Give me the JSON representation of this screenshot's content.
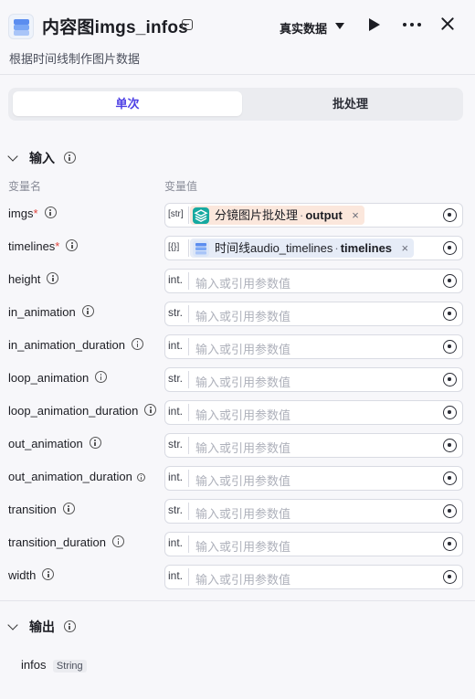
{
  "header": {
    "title": "内容图imgs_infos",
    "subtitle": "根据时间线制作图片数据",
    "data_mode": "真实数据",
    "icons": {
      "node": "layers-stack-icon",
      "badge": "node-badge-icon",
      "caret": "caret-down-icon",
      "run": "play-icon",
      "more": "more-horizontal-icon",
      "close": "close-icon"
    }
  },
  "tabs": [
    {
      "label": "单次",
      "active": true
    },
    {
      "label": "批处理",
      "active": false
    }
  ],
  "input_section": {
    "title": "输入",
    "col_name": "变量名",
    "col_value": "变量值",
    "rows": [
      {
        "name": "imgs",
        "required": true,
        "type": "[str]",
        "ref": {
          "source": "分镜图片批处理",
          "output": "output",
          "style": "orange"
        }
      },
      {
        "name": "timelines",
        "required": true,
        "type": "[{}]",
        "ref": {
          "source": "时间线audio_timelines",
          "output": "timelines",
          "style": "blue"
        }
      },
      {
        "name": "height",
        "required": false,
        "type": "int.",
        "placeholder": "输入或引用参数值"
      },
      {
        "name": "in_animation",
        "required": false,
        "type": "str.",
        "placeholder": "输入或引用参数值"
      },
      {
        "name": "in_animation_duration",
        "required": false,
        "type": "int.",
        "placeholder": "输入或引用参数值"
      },
      {
        "name": "loop_animation",
        "required": false,
        "type": "str.",
        "placeholder": "输入或引用参数值"
      },
      {
        "name": "loop_animation_duration",
        "required": false,
        "type": "int.",
        "placeholder": "输入或引用参数值"
      },
      {
        "name": "out_animation",
        "required": false,
        "type": "str.",
        "placeholder": "输入或引用参数值"
      },
      {
        "name": "out_animation_duration",
        "required": false,
        "type": "int.",
        "placeholder": "输入或引用参数值"
      },
      {
        "name": "transition",
        "required": false,
        "type": "str.",
        "placeholder": "输入或引用参数值"
      },
      {
        "name": "transition_duration",
        "required": false,
        "type": "int.",
        "placeholder": "输入或引用参数值"
      },
      {
        "name": "width",
        "required": false,
        "type": "int.",
        "placeholder": "输入或引用参数值"
      }
    ]
  },
  "output_section": {
    "title": "输出",
    "outputs": [
      {
        "name": "infos",
        "type": "String"
      }
    ]
  },
  "colors": {
    "accent": "#4e40e5",
    "required_mark": "#e0443c",
    "chip_orange": "#fbe7dc",
    "chip_blue": "#e6ecf7"
  }
}
